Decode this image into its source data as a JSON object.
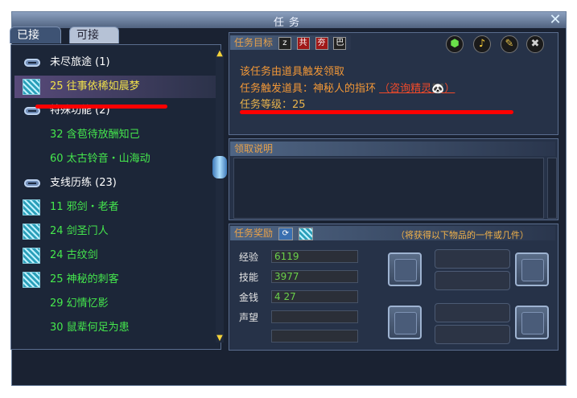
{
  "window": {
    "title": "任务",
    "close_icon": "close-x-icon"
  },
  "left": {
    "tabs": [
      {
        "label": "已接",
        "active": true
      },
      {
        "label": "可接",
        "active": false
      }
    ],
    "items": [
      {
        "kind": "category",
        "text": "未尽旅途",
        "count": "(1)"
      },
      {
        "kind": "quest",
        "text": "25 往事依稀如晨梦",
        "color": "#f0e04a",
        "icon": "scroll-icon",
        "selected": true
      },
      {
        "kind": "category",
        "text": "特殊功能",
        "count": "(2)"
      },
      {
        "kind": "quest",
        "text": "32 含苞待放酬知己",
        "color": "#45e84d"
      },
      {
        "kind": "quest",
        "text": "60 太古铃音・山海动",
        "color": "#45e84d"
      },
      {
        "kind": "category",
        "text": "支线历练",
        "count": "(23)"
      },
      {
        "kind": "quest",
        "text": "11 邪剑・老者",
        "color": "#45e84d",
        "icon": "scroll-icon"
      },
      {
        "kind": "quest",
        "text": "24 剑圣门人",
        "color": "#45e84d",
        "icon": "scroll-icon"
      },
      {
        "kind": "quest",
        "text": "24 古纹剑",
        "color": "#45e84d",
        "icon": "scroll-icon"
      },
      {
        "kind": "quest",
        "text": "25 神秘的刺客",
        "color": "#45e84d",
        "icon": "scroll-icon"
      },
      {
        "kind": "quest",
        "text": "29 幻情忆影",
        "color": "#45e84d"
      },
      {
        "kind": "quest",
        "text": "30 鼠辈何足为患",
        "color": "#45e84d"
      }
    ]
  },
  "target": {
    "header": "任务目标",
    "mini_icons": [
      "z",
      "共",
      "夯",
      "巴"
    ],
    "tool_icons": [
      "gem-icon",
      "speaker-icon",
      "broom-icon",
      "tools-icon"
    ],
    "line1": "该任务由道具触发领取",
    "line2_prefix": "任务触发道具：神秘人的指环",
    "line2_link": "（咨询精灵",
    "line2_link_end": "）",
    "line3": "任务等级：25"
  },
  "claim": {
    "header": "领取说明"
  },
  "reward": {
    "header": "任务奖励",
    "hint": "（将获得以下物品的一件或几件）",
    "rows": [
      {
        "label": "经验",
        "value": "6119"
      },
      {
        "label": "技能",
        "value": "3977"
      },
      {
        "label": "金钱",
        "value": "4 27"
      },
      {
        "label": "声望",
        "value": ""
      }
    ]
  },
  "accent": {
    "red_underline": "#ff0000"
  }
}
